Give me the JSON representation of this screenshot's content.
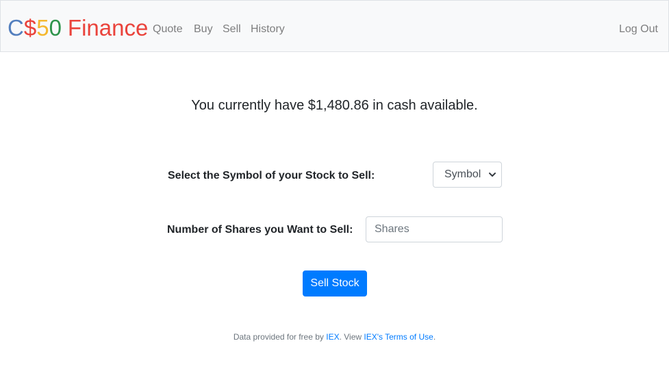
{
  "brand": {
    "part1": "C",
    "part2": "$",
    "part3": "5",
    "part4": "0",
    "part5": "Finance"
  },
  "nav": {
    "quote": "Quote",
    "buy": "Buy",
    "sell": "Sell",
    "history": "History",
    "logout": "Log Out"
  },
  "cash_message": "You currently have $1,480.86 in cash available.",
  "form": {
    "symbol_label": "Select the Symbol of your Stock to Sell:",
    "symbol_selected": "Symbol",
    "shares_label": "Number of Shares you Want to Sell:",
    "shares_placeholder": "Shares",
    "submit_label": "Sell Stock"
  },
  "footer": {
    "prefix": "Data provided for free by ",
    "iex_link": "IEX",
    "middle": ". View ",
    "terms_link": "IEX's Terms of Use",
    "suffix": "."
  },
  "colors": {
    "navbar_bg": "#f8f9fa",
    "primary": "#007bff",
    "brand_blue": "#537fbe",
    "brand_red": "#ea433b",
    "brand_yellow": "#f5b82e",
    "brand_green": "#2e944b"
  }
}
